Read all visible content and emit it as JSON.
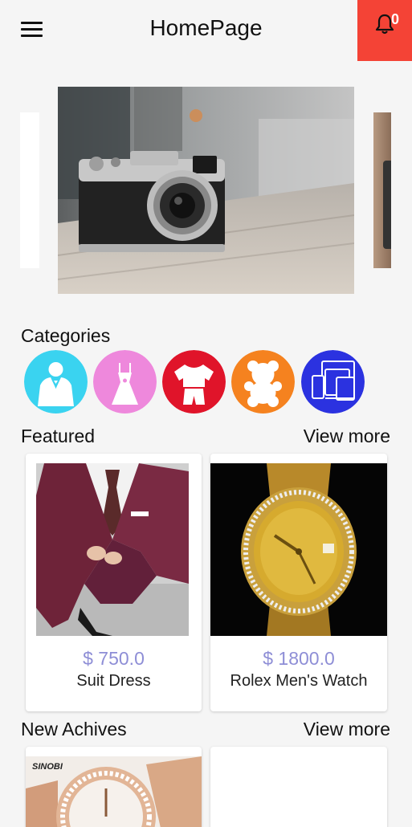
{
  "appbar": {
    "title": "HomePage",
    "notification_count": "0",
    "notification_bg": "#f44336"
  },
  "carousel": {
    "main_image": "camera-photo"
  },
  "categories": {
    "title": "Categories",
    "items": [
      {
        "name": "suit-icon",
        "bg": "#3ad3f0"
      },
      {
        "name": "dress-icon",
        "bg": "#ee88dc"
      },
      {
        "name": "tshirt-icon",
        "bg": "#e0142a"
      },
      {
        "name": "teddy-bear-icon",
        "bg": "#f5821f"
      },
      {
        "name": "devices-icon",
        "bg": "#2b32e0"
      }
    ]
  },
  "featured": {
    "title": "Featured",
    "view_more": "View more",
    "products": [
      {
        "price": "$ 750.0",
        "name": "Suit  Dress"
      },
      {
        "price": "$ 1800.0",
        "name": "Rolex Men's Watch"
      }
    ]
  },
  "new_archives": {
    "title": "New Achives",
    "view_more": "View more",
    "brand_text": "SINOBI"
  },
  "colors": {
    "price": "#8e8ed6",
    "background": "#f5f5f5"
  }
}
